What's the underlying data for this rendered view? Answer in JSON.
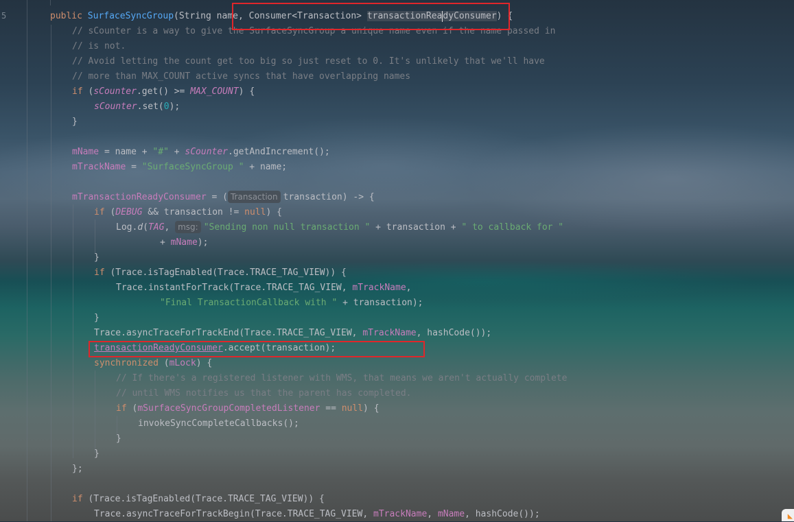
{
  "gutter": {
    "mark": "5"
  },
  "hints": {
    "param": "Transaction",
    "msg": "msg:"
  },
  "lines": {
    "l1": {
      "kw": "public ",
      "fn": "SurfaceSyncGroup",
      "a": "(String ",
      "b": "na",
      "c": "me, Consumer<Transaction> ",
      "d": "transactionRea",
      "e": "dyConsumer",
      "f": ") {"
    },
    "l2": "// sCounter is a way to give the SurfaceSyncGroup a unique name even if the name passed in",
    "l3": "// is not.",
    "l4": "// Avoid letting the count get too big so just reset to 0. It's unlikely that we'll have",
    "l5": "// more than MAX_COUNT active syncs that have overlapping names",
    "l6": {
      "kw": "if",
      "a": " (",
      "sc": "sCounter",
      "b": ".get() >= ",
      "mc": "MAX_COUNT",
      "c": ") {"
    },
    "l7": {
      "sc": "sCounter",
      "a": ".set(",
      "n": "0",
      "b": ");"
    },
    "l8": "}",
    "l9": {
      "f": "mName",
      "a": " = name + ",
      "s": "\"#\"",
      "b": " + ",
      "sc": "sCounter",
      "c": ".getAndIncrement();"
    },
    "l10": {
      "f": "mTrackName",
      "a": " = ",
      "s": "\"SurfaceSyncGroup \"",
      "b": " + name;"
    },
    "l11": {
      "f": "mTransactionReadyConsumer",
      "a": " = (",
      "b": "transaction) -> {"
    },
    "l12": {
      "kw": "if",
      "a": " (",
      "d": "DEBUG",
      "b": " && transaction != ",
      "nl": "null",
      "c": ") {"
    },
    "l13": {
      "a": "Log.",
      "dm": "d",
      "b": "(",
      "tg": "TAG",
      "c": ", ",
      "s": "\"Sending non null transaction \"",
      "d": " + transaction + ",
      "s2": "\" to callback for \""
    },
    "l14": {
      "a": "+ ",
      "f": "mName",
      "b": ");"
    },
    "l15": "}",
    "l16": {
      "kw": "if",
      "a": " (Trace.isTagEnabled(Trace.TRACE_TAG_VIEW)) {"
    },
    "l17": {
      "a": "Trace.instantForTrack(Trace.TRACE_TAG_VIEW, ",
      "f": "mTrackName",
      "b": ","
    },
    "l18": {
      "s": "\"Final TransactionCallback with \"",
      "a": " + transaction);"
    },
    "l19": "}",
    "l20": {
      "a": "Trace.asyncTraceForTrackEnd(Trace.TRACE_TAG_VIEW, ",
      "f": "mTrackName",
      "b": ", hashCode());"
    },
    "l21": {
      "f": "transactionReadyConsumer",
      "a": ".accept(transaction);"
    },
    "l22": {
      "kw": "synchronized",
      "a": " (",
      "f": "mLock",
      "b": ") {"
    },
    "l23": "// If there's a registered listener with WMS, that means we aren't actually complete",
    "l24": "// until WMS notifies us that the parent has completed.",
    "l25": {
      "kw": "if",
      "a": " (",
      "f": "mSurfaceSyncGroupCompletedListener",
      "b": " == ",
      "nl": "null",
      "c": ") {"
    },
    "l26": "invokeSyncCompleteCallbacks();",
    "l27": "}",
    "l28": "}",
    "l29": "};",
    "l30": {
      "kw": "if",
      "a": " (Trace.isTagEnabled(Trace.TRACE_TAG_VIEW)) {"
    },
    "l31": {
      "a": "Trace.asyncTraceForTrackBegin(Trace.TRACE_TAG_VIEW, ",
      "f": "mTrackName",
      "b": ", ",
      "f2": "mName",
      "c": ", hashCode());"
    }
  },
  "colors": {
    "keyword": "#cf8e6d",
    "function": "#56a8f5",
    "field": "#c77dbb",
    "string": "#6aab73",
    "number": "#2aacb8",
    "comment": "#7a7e85",
    "highlight_box": "#e0262a"
  }
}
